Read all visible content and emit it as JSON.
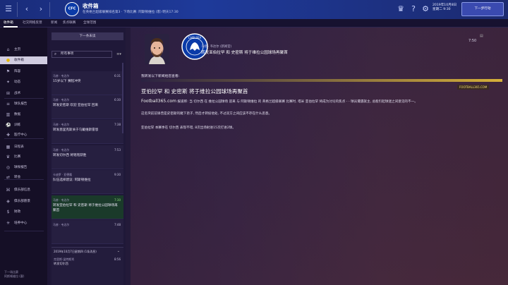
{
  "topbar": {
    "title": "收件箱",
    "subtitle": "在英格兰超级联赛排名第3 · 下场比赛: 阿斯顿维拉 (客) 明天17:30",
    "date_line1": "2019年10月8日",
    "date_line2": "星期二 9:30",
    "continue_label": "下一步行动"
  },
  "tabs": [
    "收件箱",
    "社交网络反馈",
    "新闻",
    "焦点联赛",
    "全球范围"
  ],
  "sidebar": {
    "items": [
      {
        "label": "主页",
        "icon": "home-icon",
        "glyph": "⌂"
      },
      {
        "label": "收件箱",
        "icon": "inbox-icon",
        "glyph": "●"
      },
      {
        "label": "阵容",
        "icon": "squad-icon",
        "glyph": "⚑"
      },
      {
        "label": "动态",
        "icon": "dynamics-icon",
        "glyph": "✦"
      },
      {
        "label": "战术",
        "icon": "tactics-icon",
        "glyph": "⊞"
      },
      {
        "label": "球队报告",
        "icon": "report-icon",
        "glyph": "≡"
      },
      {
        "label": "数据",
        "icon": "data-icon",
        "glyph": "▥"
      },
      {
        "label": "训练",
        "icon": "training-icon",
        "glyph": "⚽"
      },
      {
        "label": "医疗中心",
        "icon": "medical-icon",
        "glyph": "✚"
      },
      {
        "label": "日程表",
        "icon": "calendar-icon",
        "glyph": "▦"
      },
      {
        "label": "比赛",
        "icon": "competitions-icon",
        "glyph": "♛"
      },
      {
        "label": "球探报告",
        "icon": "scouting-icon",
        "glyph": "◎"
      },
      {
        "label": "转会",
        "icon": "transfers-icon",
        "glyph": "⇄"
      },
      {
        "label": "俱乐部信息",
        "icon": "club-info-icon",
        "glyph": "⌘"
      },
      {
        "label": "俱乐部愿景",
        "icon": "vision-icon",
        "glyph": "◈"
      },
      {
        "label": "财政",
        "icon": "finances-icon",
        "glyph": "$"
      },
      {
        "label": "培养中心",
        "icon": "development-icon",
        "glyph": "✳"
      }
    ],
    "footer_line1": "下一场比赛",
    "footer_line2": "阿斯顿维拉 (客)"
  },
  "list": {
    "next_button": "下一条未读",
    "filter_label": "所有事项",
    "messages": [
      {
        "from": "马修 · 韦达尔",
        "subject": "15岁以下 赛程冲突",
        "time": "6:31"
      },
      {
        "from": "马修 · 韦达尔",
        "subject": "转发史密斯 欢迎 亚伯拉罕 回来",
        "time": "6:30"
      },
      {
        "from": "马修 · 韦达尔",
        "subject": "转发恩里克斯关于乌戴维斯雷恩",
        "time": "7:38"
      },
      {
        "from": "马修 · 韦达尔",
        "subject": "转发切尔西 将铭铭获胜",
        "time": "7:53"
      },
      {
        "from": "卡迪罗 · 亚德隆",
        "subject": "队伍选择建议: 阿斯顿维拉",
        "time": "9:30"
      },
      {
        "from": "马修 · 韦达尔",
        "subject": "转发亚伯拉罕 和 史密斯 将于维拉公园球场再聚首",
        "time": "7:30"
      },
      {
        "from": "马修 · 韦达尔",
        "subject": "",
        "time": "7:48"
      }
    ],
    "preview": {
      "date": "2019年10月7日星期四 (1条消息)",
      "from": "克里斯·温特斯秀",
      "subject": "转发切尔西",
      "time": "8:56"
    }
  },
  "reader": {
    "time": "7:50",
    "sender": "马修 · 韦达尔 (新闻官)",
    "headline": "转发亚伯拉罕 和 史密斯 将于维拉公园球场再聚首",
    "intro": "我转发以下新闻给您查看:",
    "tag": "FOOTBALL365.COM",
    "article_title": "亚伯拉罕 和 史密斯 将于维拉公园球场再聚首",
    "site": "Football365.com",
    "p1": "报道称: 当 切尔西 在 维拉公园球场 迎来 与 阿斯顿维拉 的 英格兰超级联赛 比赛时, 塔米 亚伯拉罕 将成为讨论的焦点 - - 球员遭遇就主, 总能引起球迷之间意见的不一。",
    "p2": "这名突前前锋曾是史密斯的麾下弟子, 然后才转投他处, 不过双方之间应该不存在什么恶意。",
    "p3": "亚伯拉罕 本赛季在 切尔西 表现不错, 8次出场射进15次打进2球。"
  },
  "colors": {
    "accent": "#1e3a9a",
    "selected_time": "#8fdc7a",
    "gold": "#d6b03a"
  }
}
